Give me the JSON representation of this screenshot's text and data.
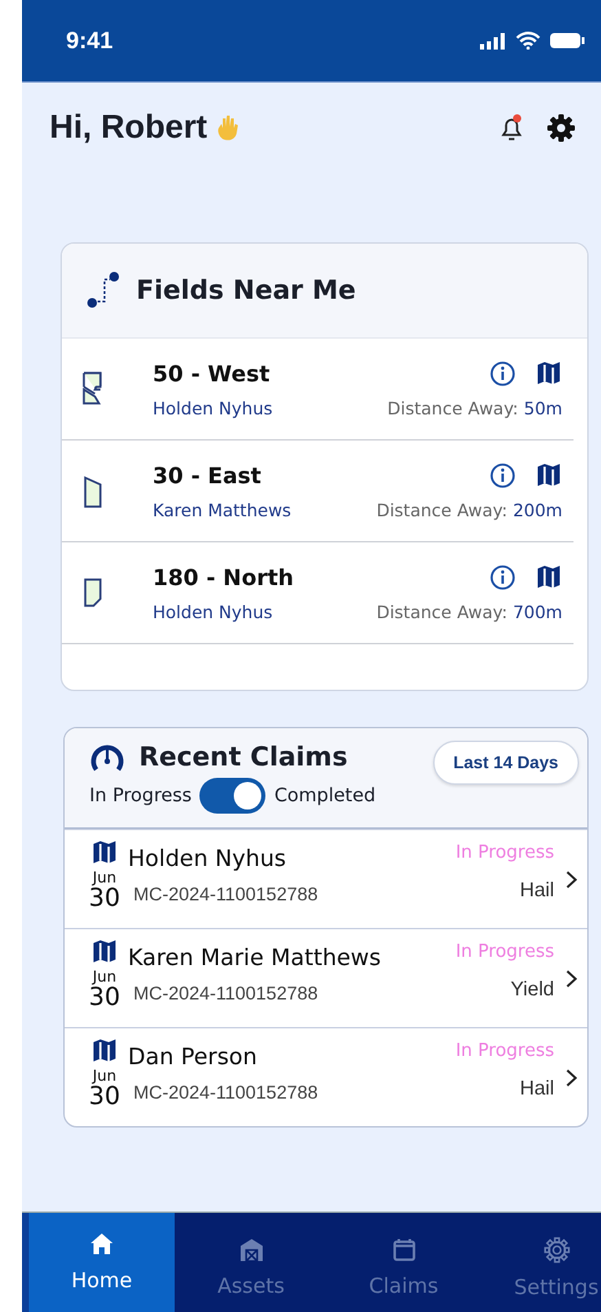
{
  "status_bar": {
    "time": "9:41"
  },
  "header": {
    "greeting": "Hi, Robert",
    "notification": true
  },
  "fields_near_me": {
    "title": "Fields Near Me",
    "fields": [
      {
        "name": "50 - West",
        "owner": "Holden Nyhus",
        "distance_label": "Distance Away:",
        "distance": "50m",
        "kind": "split"
      },
      {
        "name": "30 - East",
        "owner": "Karen Matthews",
        "distance_label": "Distance Away:",
        "distance": "200m",
        "kind": "angled-top"
      },
      {
        "name": "180 - North",
        "owner": "Holden Nyhus",
        "distance_label": "Distance Away:",
        "distance": "700m",
        "kind": "angled-bottom"
      }
    ]
  },
  "recent_claims": {
    "title": "Recent Claims",
    "range_button": "Last 14 Days",
    "toggle": {
      "left_label": "In Progress",
      "right_label": "Completed",
      "on": true
    },
    "claims": [
      {
        "month": "Jun",
        "day": "30",
        "name": "Holden Nyhus",
        "number": "MC-2024-1100152788",
        "status": "In Progress",
        "type": "Hail"
      },
      {
        "month": "Jun",
        "day": "30",
        "name": "Karen Marie Matthews",
        "number": "MC-2024-1100152788",
        "status": "In Progress",
        "type": "Yield"
      },
      {
        "month": "Jun",
        "day": "30",
        "name": "Dan Person",
        "number": "MC-2024-1100152788",
        "status": "In Progress",
        "type": "Hail"
      }
    ]
  },
  "tab_bar": [
    {
      "label": "Home",
      "selected": true,
      "kind": "home"
    },
    {
      "label": "Assets",
      "selected": false,
      "kind": "barn"
    },
    {
      "label": "Claims",
      "selected": false,
      "kind": "calendar"
    },
    {
      "label": "Settings",
      "selected": false,
      "kind": "gear"
    }
  ]
}
